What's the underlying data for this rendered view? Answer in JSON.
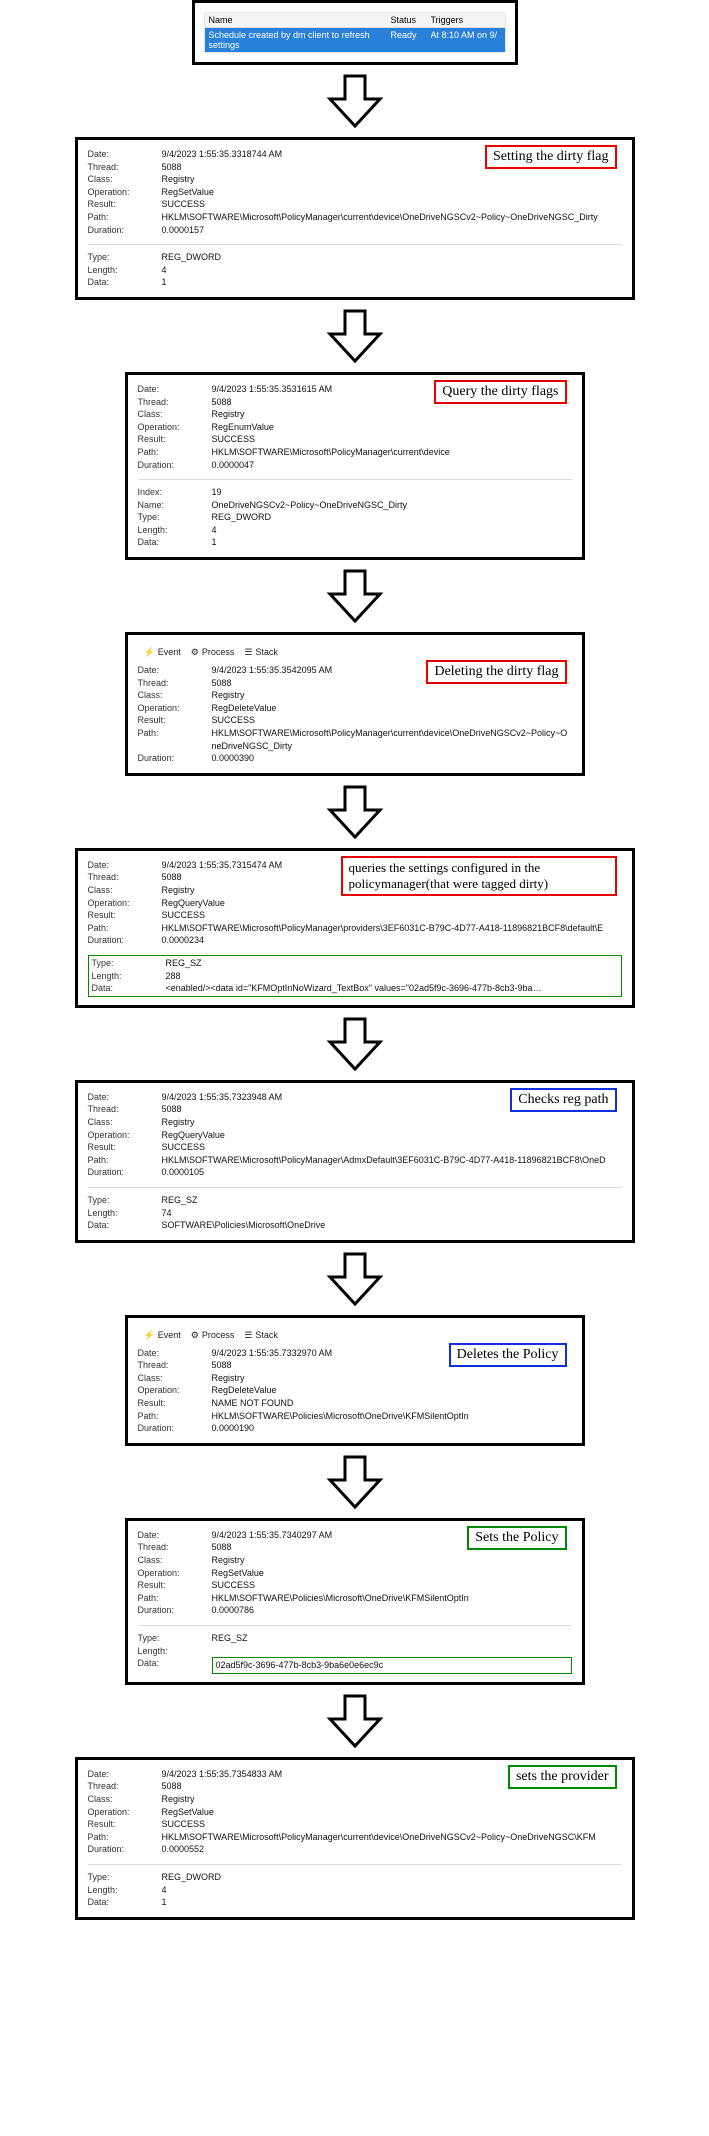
{
  "scheduler": {
    "headers": {
      "name": "Name",
      "status": "Status",
      "triggers": "Triggers"
    },
    "row": {
      "name": "Schedule created by dm client to refresh settings",
      "status": "Ready",
      "triggers": "At 8:10 AM on 9/"
    }
  },
  "tabs": {
    "event": "Event",
    "process": "Process",
    "stack": "Stack"
  },
  "panels": [
    {
      "id": "p1",
      "callout": {
        "text": "Setting the dirty flag",
        "style": "red"
      },
      "rows": {
        "Date": "9/4/2023 1:55:35.3318744 AM",
        "Thread": "5088",
        "Class": "Registry",
        "Operation": "RegSetValue",
        "Result": "SUCCESS",
        "Path": "HKLM\\SOFTWARE\\Microsoft\\PolicyManager\\current\\device\\OneDriveNGSCv2~Policy~OneDriveNGSC_Dirty",
        "Duration": "0.0000157"
      },
      "extra": {
        "Type": "REG_DWORD",
        "Length": "4",
        "Data": "1"
      }
    },
    {
      "id": "p2",
      "callout": {
        "text": "Query the dirty flags",
        "style": "red"
      },
      "rows": {
        "Date": "9/4/2023 1:55:35.3531615 AM",
        "Thread": "5088",
        "Class": "Registry",
        "Operation": "RegEnumValue",
        "Result": "SUCCESS",
        "Path": "HKLM\\SOFTWARE\\Microsoft\\PolicyManager\\current\\device",
        "Duration": "0.0000047"
      },
      "extra": {
        "Index": "19",
        "Name": "OneDriveNGSCv2~Policy~OneDriveNGSC_Dirty",
        "Type": "REG_DWORD",
        "Length": "4",
        "Data": "1"
      }
    },
    {
      "id": "p3",
      "callout": {
        "text": "Deleting the dirty flag",
        "style": "red"
      },
      "tabs": true,
      "rows": {
        "Date": "9/4/2023 1:55:35.3542095 AM",
        "Thread": "5088",
        "Class": "Registry",
        "Operation": "RegDeleteValue",
        "Result": "SUCCESS",
        "Path": "HKLM\\SOFTWARE\\Microsoft\\PolicyManager\\current\\device\\OneDriveNGSCv2~Policy~OneDriveNGSC_Dirty",
        "Duration": "0.0000390"
      }
    },
    {
      "id": "p4",
      "callout": {
        "text": "queries the settings configured in the policymanager(that were tagged dirty)",
        "style": "red",
        "multiline": true
      },
      "rows": {
        "Date": "9/4/2023 1:55:35.7315474 AM",
        "Thread": "5088",
        "Class": "Registry",
        "Operation": "RegQueryValue",
        "Result": "SUCCESS",
        "Path": "HKLM\\SOFTWARE\\Microsoft\\PolicyManager\\providers\\3EF6031C-B79C-4D77-A418-11896821BCF8\\default\\E",
        "Duration": "0.0000234"
      },
      "extra": {
        "Type": "REG_SZ",
        "Length": "288",
        "Data": "<enabled/><data id=\"KFMOptInNoWizard_TextBox\" values=\"02ad5f9c-3696-477b-8cb3-9ba…"
      },
      "extraGreen": true
    },
    {
      "id": "p5",
      "callout": {
        "text": "Checks reg path",
        "style": "blue"
      },
      "rows": {
        "Date": "9/4/2023 1:55:35.7323948 AM",
        "Thread": "5088",
        "Class": "Registry",
        "Operation": "RegQueryValue",
        "Result": "SUCCESS",
        "Path": "HKLM\\SOFTWARE\\Microsoft\\PolicyManager\\AdmxDefault\\3EF6031C-B79C-4D77-A418-11896821BCF8\\OneD",
        "Duration": "0.0000105"
      },
      "extra": {
        "Type": "REG_SZ",
        "Length": "74",
        "Data": "SOFTWARE\\Policies\\Microsoft\\OneDrive"
      }
    },
    {
      "id": "p6",
      "callout": {
        "text": "Deletes the Policy",
        "style": "blue"
      },
      "tabs": true,
      "rows": {
        "Date": "9/4/2023 1:55:35.7332970 AM",
        "Thread": "5088",
        "Class": "Registry",
        "Operation": "RegDeleteValue",
        "Result": "NAME NOT FOUND",
        "Path": "HKLM\\SOFTWARE\\Policies\\Microsoft\\OneDrive\\KFMSilentOptIn",
        "Duration": "0.0000190"
      }
    },
    {
      "id": "p7",
      "callout": {
        "text": "Sets the Policy",
        "style": "green"
      },
      "rows": {
        "Date": "9/4/2023 1:55:35.7340297 AM",
        "Thread": "5088",
        "Class": "Registry",
        "Operation": "RegSetValue",
        "Result": "SUCCESS",
        "Path": "HKLM\\SOFTWARE\\Policies\\Microsoft\\OneDrive\\KFMSilentOptIn",
        "Duration": "0.0000786"
      },
      "extra": {
        "Type": "REG_SZ",
        "Length": "",
        "Data": "02ad5f9c-3696-477b-8cb3-9ba6e0e6ec9c"
      },
      "extraDataGreen": true
    },
    {
      "id": "p8",
      "callout": {
        "text": "sets the provider",
        "style": "green"
      },
      "rows": {
        "Date": "9/4/2023 1:55:35.7354833 AM",
        "Thread": "5088",
        "Class": "Registry",
        "Operation": "RegSetValue",
        "Result": "SUCCESS",
        "Path": "HKLM\\SOFTWARE\\Microsoft\\PolicyManager\\current\\device\\OneDriveNGSCv2~Policy~OneDriveNGSC\\KFM",
        "Duration": "0.0000552"
      },
      "extra": {
        "Type": "REG_DWORD",
        "Length": "4",
        "Data": "1"
      }
    }
  ]
}
